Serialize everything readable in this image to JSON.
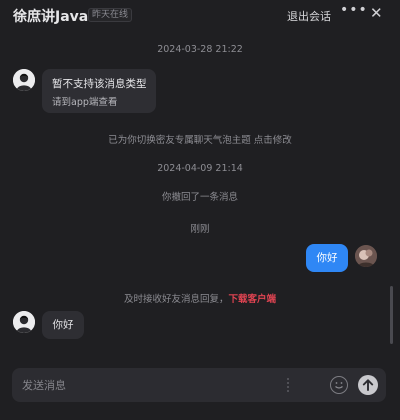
{
  "header": {
    "title": "徐庶讲Java",
    "status": "昨天在线",
    "exit_label": "退出会话",
    "more_label": "•••",
    "close_label": "✕"
  },
  "messages": {
    "time1": "2024-03-28 21:22",
    "unsupported_title": "暂不支持该消息类型",
    "unsupported_sub": "请到app端查看",
    "theme_notice": "已为你切换密友专属聊天气泡主题 点击修改",
    "time2": "2024-04-09 21:14",
    "recall_notice": "你撤回了一条消息",
    "just_now": "刚刚",
    "out_text": "你好",
    "tip_prefix": "及时接收好友消息回复，",
    "tip_link": "下载客户端",
    "in_text": "你好"
  },
  "input": {
    "placeholder": "发送消息",
    "emoji_icon": "smile-icon",
    "send_icon": "arrow-up-icon"
  },
  "colors": {
    "background": "#1f1f22",
    "bubble_out": "#2f87f5",
    "bubble_in": "#2e2e33",
    "link": "#e04452"
  }
}
